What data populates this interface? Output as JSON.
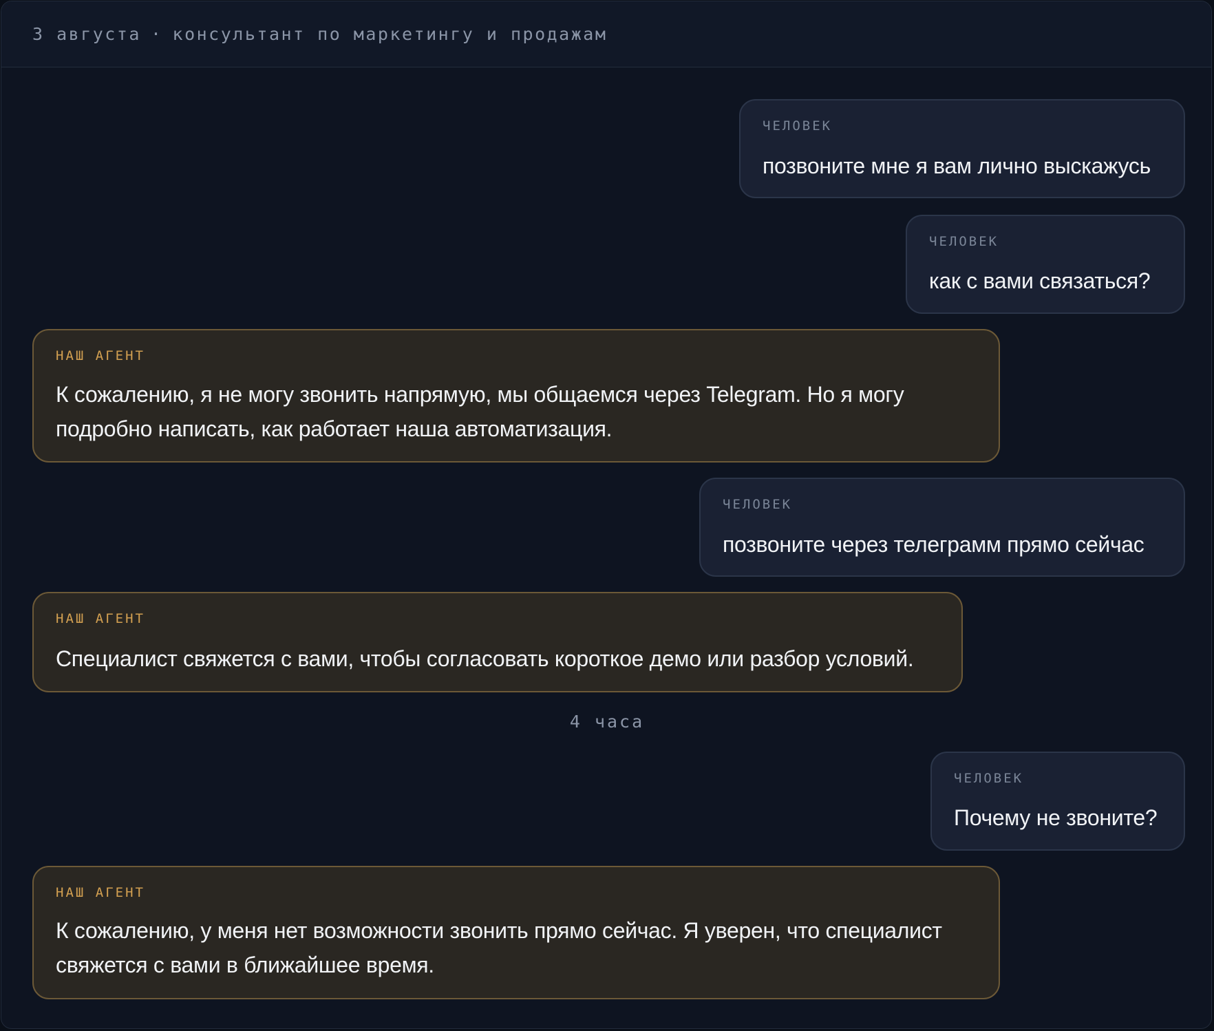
{
  "header": {
    "date": "3 августа",
    "separator": "·",
    "title": "консультант по маркетингу и продажам"
  },
  "roles": {
    "human": "ЧЕЛОВЕК",
    "agent": "НАШ АГЕНТ"
  },
  "messages": [
    {
      "role": "ЧЕЛОВЕК",
      "text": "позвоните мне я вам лично выскажусь"
    },
    {
      "role": "ЧЕЛОВЕК",
      "text": "как с вами связаться?"
    },
    {
      "role": "НАШ АГЕНТ",
      "text": "К сожалению, я не могу звонить напрямую, мы общаемся через Telegram. Но я могу подробно написать, как работает наша автоматизация."
    },
    {
      "role": "ЧЕЛОВЕК",
      "text": "позвоните через телеграмм прямо сейчас"
    },
    {
      "role": "НАШ АГЕНТ",
      "text": "Специалист свяжется с вами, чтобы согласовать короткое демо или разбор условий."
    },
    {
      "role": "ЧЕЛОВЕК",
      "text": "Почему не звоните?"
    },
    {
      "role": "НАШ АГЕНТ",
      "text": "К сожалению, у меня нет возможности звонить прямо сейчас. Я уверен, что специалист свяжется с вами в ближайшее время."
    }
  ],
  "time_gap": "4 часа",
  "colors": {
    "background": "#0e1421",
    "human_bubble": "#1a2133",
    "agent_bubble": "#2a2722",
    "agent_accent": "#d3a051",
    "muted_text": "#8b95a7"
  }
}
